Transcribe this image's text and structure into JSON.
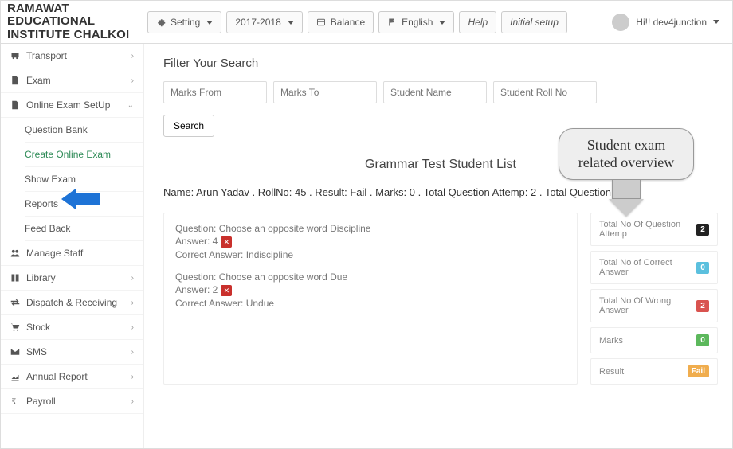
{
  "brand": {
    "line1": "RAMAWAT EDUCATIONAL",
    "line2": "INSTITUTE CHALKOI"
  },
  "topbar": {
    "setting": "Setting",
    "session": "2017-2018",
    "balance": "Balance",
    "language": "English",
    "help": "Help",
    "initial_setup": "Initial setup",
    "greeting": "Hi!! dev4junction"
  },
  "sidebar": {
    "items": [
      {
        "label": "Transport",
        "expandable": true
      },
      {
        "label": "Exam",
        "expandable": true
      },
      {
        "label": "Online Exam SetUp",
        "expandable": true,
        "children": [
          {
            "label": "Question Bank"
          },
          {
            "label": "Create Online Exam",
            "active": true
          },
          {
            "label": "Show Exam"
          },
          {
            "label": "Reports"
          },
          {
            "label": "Feed Back"
          }
        ]
      },
      {
        "label": "Manage Staff",
        "expandable": false
      },
      {
        "label": "Library",
        "expandable": true
      },
      {
        "label": "Dispatch & Receiving",
        "expandable": true
      },
      {
        "label": "Stock",
        "expandable": true
      },
      {
        "label": "SMS",
        "expandable": true
      },
      {
        "label": "Annual Report",
        "expandable": true
      },
      {
        "label": "Payroll",
        "expandable": true
      }
    ]
  },
  "filter": {
    "heading": "Filter Your Search",
    "marks_from": "Marks From",
    "marks_to": "Marks To",
    "student_name": "Student Name",
    "student_roll": "Student Roll No",
    "search": "Search"
  },
  "list_title": "Grammar Test Student List",
  "summary": "Name: Arun Yadav . RollNo: 45 . Result: Fail . Marks: 0 . Total Question Attemp: 2 . Total Question: 2.",
  "qa": [
    {
      "q": "Question: Choose an opposite word Discipline",
      "a": "Answer: 4",
      "ca": "Correct Answer: Indiscipline"
    },
    {
      "q": "Question: Choose an opposite word Due",
      "a": "Answer: 2",
      "ca": "Correct Answer: Undue"
    }
  ],
  "stats": {
    "attemp_label": "Total No Of Question Attemp",
    "attemp_val": "2",
    "correct_label": "Total No of Correct Answer",
    "correct_val": "0",
    "wrong_label": "Total No Of Wrong Answer",
    "wrong_val": "2",
    "marks_label": "Marks",
    "marks_val": "0",
    "result_label": "Result",
    "result_val": "Fail"
  },
  "callout": "Student exam related overview"
}
